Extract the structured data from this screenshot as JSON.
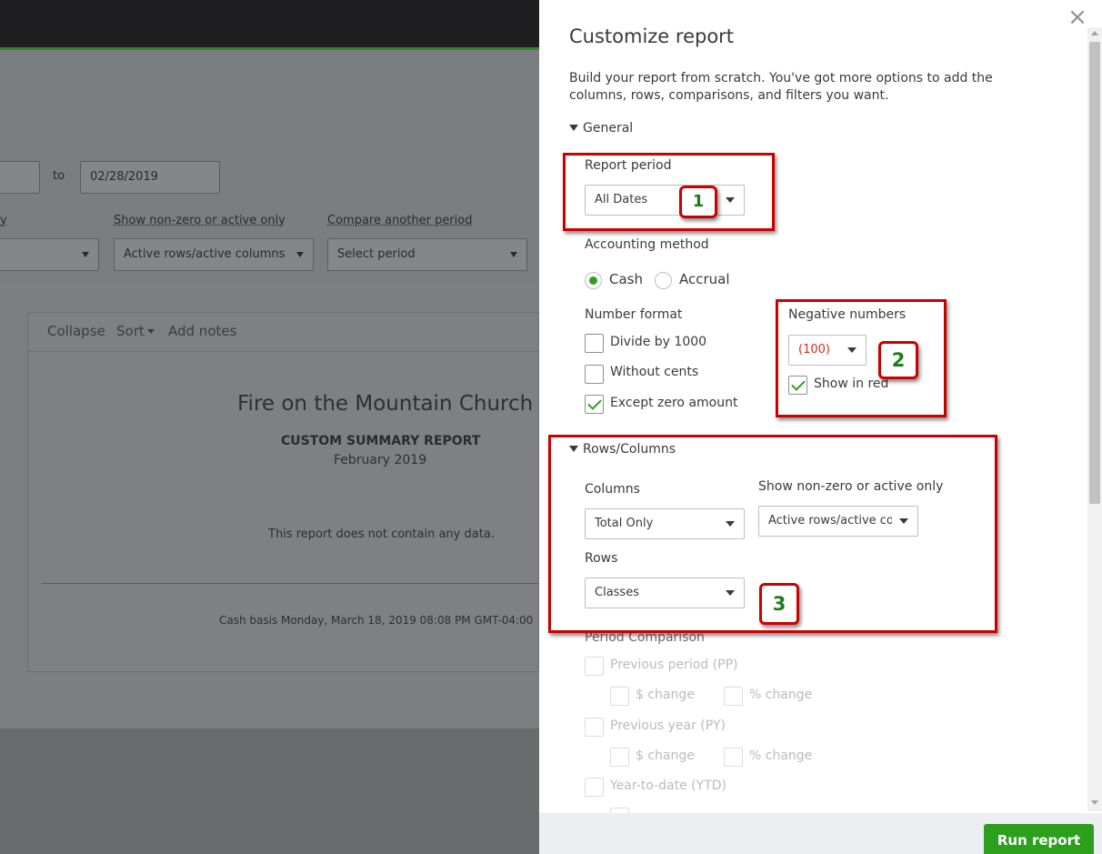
{
  "background": {
    "date_to_word": "to",
    "date_to_value": "02/28/2019",
    "filter_label_partial": "y",
    "show_nonzero_label": "Show non-zero or active only",
    "compare_label": "Compare another period",
    "active_rows_value": "Active rows/active columns",
    "select_period_value": "Select period",
    "toolbar": {
      "collapse": "Collapse",
      "sort": "Sort",
      "add_notes": "Add notes"
    },
    "company_name": "Fire on the Mountain Church",
    "report_title": "CUSTOM SUMMARY REPORT",
    "report_date": "February 2019",
    "no_data_message": "This report does not contain any data.",
    "footer_text": "Cash basis  Monday, March 18, 2019  08:08 PM GMT-04:00"
  },
  "panel": {
    "title": "Customize report",
    "description": "Build your report from scratch. You've got more options to add the columns, rows, comparisons, and filters you want.",
    "general": {
      "toggle": "General",
      "report_period_label": "Report period",
      "report_period_value": "All Dates",
      "accounting_method_label": "Accounting method",
      "cash_label": "Cash",
      "accrual_label": "Accrual",
      "selected_method": "Cash",
      "number_format_label": "Number format",
      "divide_1000": "Divide by 1000",
      "without_cents": "Without cents",
      "except_zero": "Except zero amount",
      "negative_numbers_label": "Negative numbers",
      "negative_value": "(100)",
      "show_in_red": "Show in red"
    },
    "rows_columns": {
      "toggle": "Rows/Columns",
      "columns_label": "Columns",
      "columns_value": "Total Only",
      "show_nonzero_label": "Show non-zero or active only",
      "show_nonzero_value": "Active rows/active columns",
      "rows_label": "Rows",
      "rows_value": "Classes"
    },
    "period_comparison": {
      "label": "Period Comparison",
      "previous_period": "Previous period (PP)",
      "pp_dollar_change": "$ change",
      "pp_pct_change": "% change",
      "previous_year": "Previous year (PY)",
      "py_dollar_change": "$ change",
      "py_pct_change": "% change",
      "ytd": "Year-to-date (YTD)"
    },
    "run_report": "Run report",
    "annotations": {
      "one": "1",
      "two": "2",
      "three": "3"
    },
    "colors": {
      "accent": "#2ca01c",
      "annotation": "#cd0000",
      "negative": "#d52b1e"
    }
  }
}
